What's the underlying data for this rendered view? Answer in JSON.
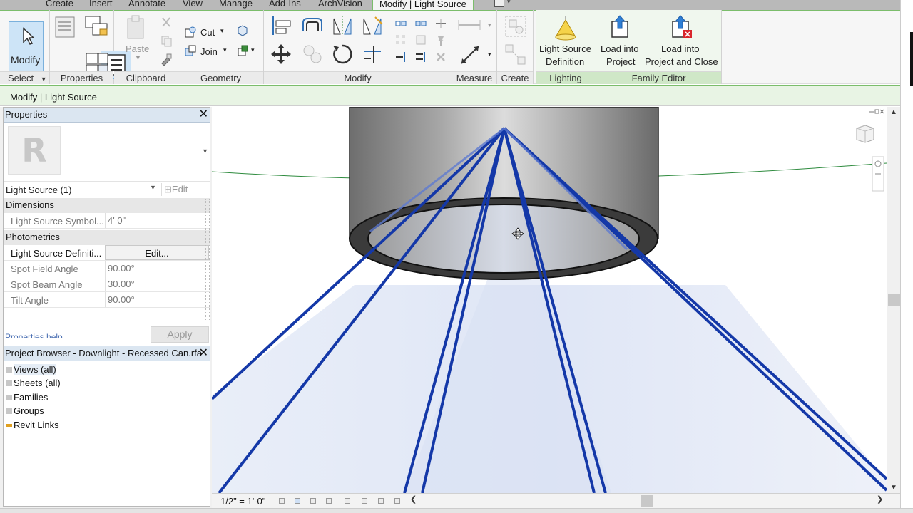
{
  "ribbon_tabs": [
    "Create",
    "Insert",
    "Annotate",
    "View",
    "Manage",
    "Add-Ins",
    "ArchVision"
  ],
  "active_tab": "Modify | Light Source",
  "ribbon": {
    "select": {
      "modify_label": "Modify",
      "panel_label": "Select"
    },
    "properties": {
      "panel_label": "Properties"
    },
    "clipboard": {
      "paste_label": "Paste",
      "panel_label": "Clipboard"
    },
    "geometry": {
      "cut_label": "Cut",
      "join_label": "Join",
      "panel_label": "Geometry"
    },
    "modify": {
      "panel_label": "Modify"
    },
    "measure": {
      "panel_label": "Measure"
    },
    "create": {
      "panel_label": "Create"
    },
    "lighting": {
      "button_line1": "Light Source",
      "button_line2": "Definition",
      "panel_label": "Lighting"
    },
    "family_editor": {
      "load_line1": "Load into",
      "load_line2": "Project",
      "load_close_line1": "Load into",
      "load_close_line2": "Project and Close",
      "panel_label": "Family Editor"
    }
  },
  "context_bar": "Modify | Light Source",
  "properties": {
    "title": "Properties",
    "instance_selector": "Light Source (1)",
    "edit_type": "Edit Type",
    "groups": {
      "dimensions": "Dimensions",
      "photometrics": "Photometrics"
    },
    "rows": [
      {
        "key": "Light Source Symbol...",
        "value": "4'  0\""
      },
      {
        "key": "Light Source Definiti...",
        "value": "Edit..."
      },
      {
        "key": "Spot Field Angle",
        "value": "90.00°"
      },
      {
        "key": "Spot Beam Angle",
        "value": "30.00°"
      },
      {
        "key": "Tilt Angle",
        "value": "90.00°"
      }
    ],
    "help_link": "Properties help",
    "apply_label": "Apply"
  },
  "project_browser": {
    "title": "Project Browser - Downlight - Recessed Can.rfa",
    "items": [
      "Views (all)",
      "Sheets (all)",
      "Families",
      "Groups",
      "Revit Links"
    ]
  },
  "view_bar": {
    "scale": "1/2\" = 1'-0\""
  },
  "colors": {
    "ribbon_accent": "#7bbd6b",
    "light_ray": "#1438a8",
    "palette_title": "#dbe6f1"
  }
}
